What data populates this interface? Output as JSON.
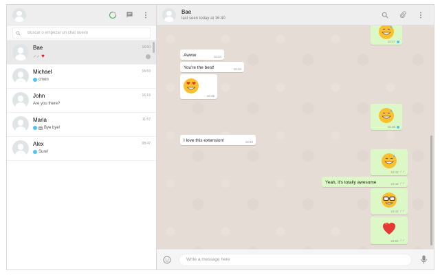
{
  "sidebar": {
    "search_placeholder": "Buscar o empezar un chat nuevo",
    "chats": [
      {
        "name": "Bae",
        "time": "16:50",
        "preview": "",
        "active": true
      },
      {
        "name": "Michael",
        "time": "16:53",
        "preview": "cmon"
      },
      {
        "name": "John",
        "time": "16:19",
        "preview": "Are you there?"
      },
      {
        "name": "Maria",
        "time": "11:57",
        "preview": "Bye bye!"
      },
      {
        "name": "Alex",
        "time": "08:47",
        "preview": "Sure!"
      }
    ]
  },
  "conversation": {
    "contact_name": "Bae",
    "status": "last seen today at 16:40",
    "compose_placeholder": "Write a message here",
    "messages": [
      {
        "direction": "out",
        "emoji": "grin-sweat-emoji",
        "time": "16:27",
        "tick": "blue"
      },
      {
        "direction": "in",
        "text": "Awww",
        "time": "16:34"
      },
      {
        "direction": "in",
        "text": "You're the best!",
        "time": "16:34"
      },
      {
        "direction": "in",
        "emoji": "heart-eyes-emoji",
        "time": "16:35"
      },
      {
        "direction": "out",
        "emoji": "grin-sweat-emoji",
        "time": "16:39",
        "tick": "blue"
      },
      {
        "direction": "in",
        "text": "I love this extension!",
        "time": "16:40"
      },
      {
        "direction": "out",
        "emoji": "grin-sweat-emoji",
        "time": "16:42",
        "tick": "gray"
      },
      {
        "direction": "out",
        "text": "Yeah, it's totally awesome",
        "time": "16:42",
        "tick": "gray"
      },
      {
        "direction": "out",
        "emoji": "sunglasses-nerd-emoji",
        "time": "16:42",
        "tick": "gray"
      },
      {
        "direction": "out",
        "emoji": "red-heart-emoji",
        "time": "16:50",
        "tick": "gray"
      }
    ]
  },
  "colors": {
    "outgoing": "#dcf8c6",
    "incoming": "#ffffff",
    "wallpaper": "#e5ddd5",
    "blue_tick": "#4fc3f7"
  }
}
